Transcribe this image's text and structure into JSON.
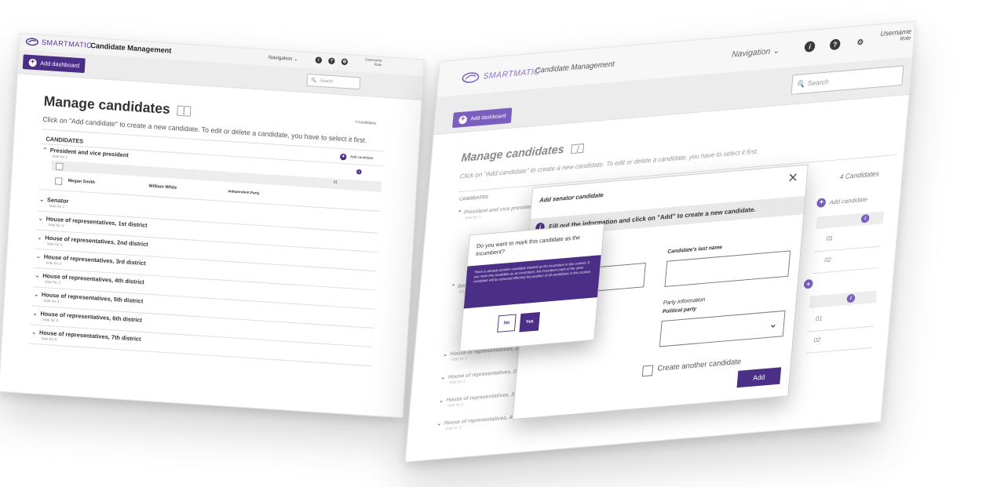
{
  "app": {
    "brand": "SMARTMATIC",
    "title": "Candidate Management",
    "nav_label": "Navigation",
    "username": "Username",
    "role": "Role",
    "add_dashboard": "Add dashboard",
    "search_placeholder": "Search",
    "accent_color": "#4b2f86"
  },
  "page": {
    "title": "Manage candidates",
    "instructions": "Click on \"Add candidate\" to create a new candidate. To edit or delete a candidate, you have to select it first.",
    "count_label": "4 Candidates",
    "candidates_header": "CANDIDATES",
    "add_candidate": "Add candidate"
  },
  "sections": [
    {
      "title": "President and vice president",
      "sub": "Vote for 1",
      "expanded": true
    },
    {
      "title": "Senator",
      "sub": "Vote for 1"
    },
    {
      "title": "House of representatives, 1st district",
      "sub": "Vote for 3"
    },
    {
      "title": "House of representatives, 2nd district",
      "sub": "Vote for 3"
    },
    {
      "title": "House of representatives, 3rd district",
      "sub": "Vote for 3"
    },
    {
      "title": "House of representatives, 4th district",
      "sub": "Vote for 3"
    },
    {
      "title": "House of representatives, 5th district",
      "sub": "Vote for 3"
    },
    {
      "title": "House of representatives, 6th district",
      "sub": "Vote for 3"
    },
    {
      "title": "House of representatives, 7th district",
      "sub": "Vote for 3"
    }
  ],
  "candidate_row": {
    "first": "Megan Smith",
    "second": "William White",
    "party": "Independent Party",
    "id": "01"
  },
  "right_sections": [
    {
      "title": "President and vice president",
      "sub": "Vote for 1"
    },
    {
      "title": "Senator",
      "sub": "Vote for 1"
    },
    {
      "title": "House of representatives, 1st district",
      "sub": "Vote for 2"
    },
    {
      "title": "House of representatives, 2nd district",
      "sub": "Vote for 2"
    },
    {
      "title": "House of representatives, 3rd district",
      "sub": "Vote for 2"
    },
    {
      "title": "House of representatives, 4th district",
      "sub": "Vote for 3"
    }
  ],
  "right_table": {
    "ids_a": [
      "01",
      "02"
    ],
    "ids_b": [
      "01",
      "02"
    ]
  },
  "modal": {
    "title": "Add senator candidate",
    "info": "Fill out the information and click on \"Add\" to create a new candidate.",
    "last_name_label": "Candidate's last name",
    "party_info": "Party information",
    "party_label": "Political party",
    "create_another": "Create another candidate",
    "add_button": "Add",
    "close": "×"
  },
  "popup": {
    "question": "Do you want to mark this candidate as the incumbent?",
    "body": "There is already another candidate marked as the incumbent in this contest. If you mark this candidate as an incumbent, the incumbent mark of the other candidate will be removed affecting the position of all candidates in this contest.",
    "no": "No",
    "yes": "Yes"
  }
}
